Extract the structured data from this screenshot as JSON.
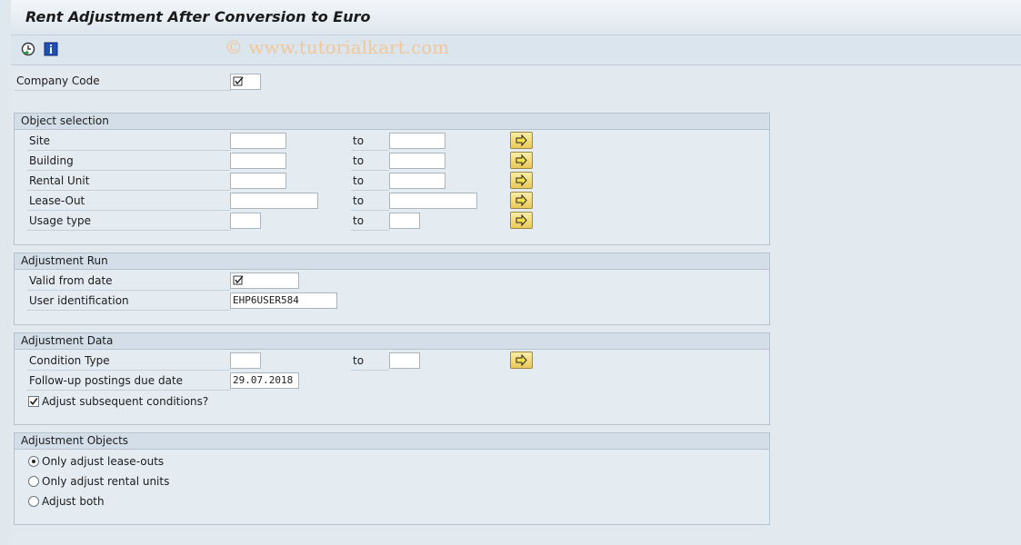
{
  "window": {
    "title": "Rent Adjustment After Conversion to Euro"
  },
  "toolbar": {
    "watermark": "© www.tutorialkart.com",
    "execute_icon": "execute-clock-icon",
    "info_icon": "info-icon"
  },
  "company_code": {
    "label": "Company Code",
    "value": ""
  },
  "object_selection": {
    "title": "Object selection",
    "to_label": "to",
    "rows": [
      {
        "label": "Site",
        "from": "",
        "to": ""
      },
      {
        "label": "Building",
        "from": "",
        "to": ""
      },
      {
        "label": "Rental Unit",
        "from": "",
        "to": ""
      },
      {
        "label": "Lease-Out",
        "from": "",
        "to": ""
      },
      {
        "label": "Usage type",
        "from": "",
        "to": ""
      }
    ]
  },
  "adjustment_run": {
    "title": "Adjustment Run",
    "valid_from_label": "Valid from date",
    "valid_from_value": "",
    "user_id_label": "User identification",
    "user_id_value": "EHP6USER584"
  },
  "adjustment_data": {
    "title": "Adjustment Data",
    "condition_type_label": "Condition Type",
    "to_label": "to",
    "followup_label": "Follow-up postings due date",
    "followup_value": "29.07.2018",
    "adjust_subsequent_label": "Adjust subsequent conditions?",
    "adjust_subsequent_checked": true
  },
  "adjustment_objects": {
    "title": "Adjustment Objects",
    "options": [
      {
        "label": "Only adjust lease-outs",
        "selected": true
      },
      {
        "label": "Only adjust rental units",
        "selected": false
      },
      {
        "label": "Adjust both",
        "selected": false
      }
    ]
  },
  "colors": {
    "multi_select_button": "#e9c95b",
    "background": "#dfe8ef"
  }
}
